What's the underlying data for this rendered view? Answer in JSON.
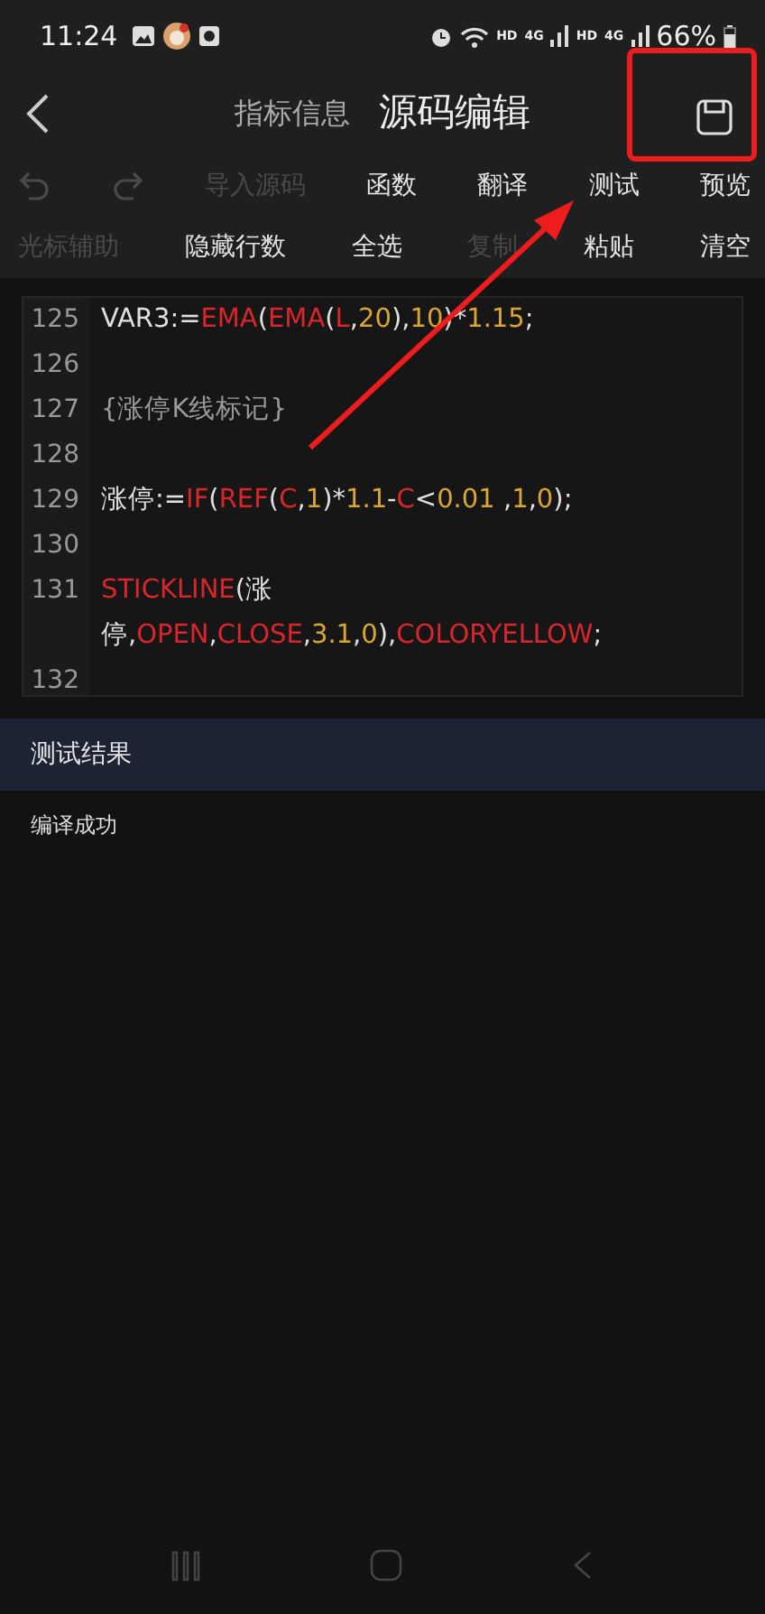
{
  "status_bar": {
    "time": "11:24",
    "signals": [
      {
        "label": "HD",
        "gen": "4G"
      },
      {
        "label": "HD",
        "gen": "4G"
      }
    ],
    "battery": "66%"
  },
  "header": {
    "subtitle": "指标信息",
    "title": "源码编辑"
  },
  "toolbar_rows": [
    [
      {
        "kind": "undo",
        "disabled": true
      },
      {
        "kind": "redo",
        "disabled": true
      },
      {
        "kind": "text",
        "label": "导入源码",
        "disabled": true
      },
      {
        "kind": "text",
        "label": "函数",
        "disabled": false
      },
      {
        "kind": "text",
        "label": "翻译",
        "disabled": false
      },
      {
        "kind": "text",
        "label": "测试",
        "disabled": false
      },
      {
        "kind": "text",
        "label": "预览",
        "disabled": false
      }
    ],
    [
      {
        "kind": "text",
        "label": "光标辅助",
        "disabled": true
      },
      {
        "kind": "text",
        "label": "隐藏行数",
        "disabled": false
      },
      {
        "kind": "text",
        "label": "全选",
        "disabled": false
      },
      {
        "kind": "text",
        "label": "复制",
        "disabled": true
      },
      {
        "kind": "text",
        "label": "粘贴",
        "disabled": false
      },
      {
        "kind": "text",
        "label": "清空",
        "disabled": false
      }
    ]
  ],
  "editor": {
    "lines": [
      {
        "number": "125",
        "tokens": [
          {
            "text": "VAR3:=",
            "kind": "plain"
          },
          {
            "text": "EMA",
            "kind": "func"
          },
          {
            "text": "(",
            "kind": "plain"
          },
          {
            "text": "EMA",
            "kind": "func"
          },
          {
            "text": "(",
            "kind": "plain"
          },
          {
            "text": "L",
            "kind": "func"
          },
          {
            "text": ",",
            "kind": "plain"
          },
          {
            "text": "20",
            "kind": "num"
          },
          {
            "text": "),",
            "kind": "plain"
          },
          {
            "text": "10",
            "kind": "num"
          },
          {
            "text": ")*",
            "kind": "plain"
          },
          {
            "text": "1.15",
            "kind": "num"
          },
          {
            "text": ";",
            "kind": "plain"
          }
        ]
      },
      {
        "number": "126"
      },
      {
        "number": "127",
        "tokens": [
          {
            "text": "{涨停K线标记}",
            "kind": "comment"
          }
        ]
      },
      {
        "number": "128"
      },
      {
        "number": "129",
        "tokens": [
          {
            "text": "涨停:=",
            "kind": "plain"
          },
          {
            "text": "IF",
            "kind": "func"
          },
          {
            "text": "(",
            "kind": "plain"
          },
          {
            "text": "REF",
            "kind": "func"
          },
          {
            "text": "(",
            "kind": "plain"
          },
          {
            "text": "C",
            "kind": "func"
          },
          {
            "text": ",",
            "kind": "plain"
          },
          {
            "text": "1",
            "kind": "num"
          },
          {
            "text": ")*",
            "kind": "plain"
          },
          {
            "text": "1.1",
            "kind": "num"
          },
          {
            "text": "-",
            "kind": "plain"
          },
          {
            "text": "C",
            "kind": "func"
          },
          {
            "text": "<",
            "kind": "plain"
          },
          {
            "text": "0.01",
            "kind": "num"
          },
          {
            "text": " ,",
            "kind": "plain"
          },
          {
            "text": "1",
            "kind": "num"
          },
          {
            "text": ",",
            "kind": "plain"
          },
          {
            "text": "0",
            "kind": "num"
          },
          {
            "text": ");",
            "kind": "plain"
          }
        ]
      },
      {
        "number": "130"
      },
      {
        "number": "131",
        "tokens": [
          {
            "text": "STICKLINE",
            "kind": "func"
          },
          {
            "text": "(涨",
            "kind": "plain",
            "wrap_after": true
          },
          {
            "text": "停,",
            "kind": "plain"
          },
          {
            "text": "OPEN",
            "kind": "func"
          },
          {
            "text": ",",
            "kind": "plain"
          },
          {
            "text": "CLOSE",
            "kind": "func"
          },
          {
            "text": ",",
            "kind": "plain"
          },
          {
            "text": "3.1",
            "kind": "num"
          },
          {
            "text": ",",
            "kind": "plain"
          },
          {
            "text": "0",
            "kind": "num"
          },
          {
            "text": "),",
            "kind": "plain"
          },
          {
            "text": "COLORYELLOW",
            "kind": "func"
          },
          {
            "text": ";",
            "kind": "plain"
          }
        ]
      },
      {
        "number": "132"
      }
    ]
  },
  "result": {
    "title": "测试结果",
    "message": "编译成功"
  }
}
